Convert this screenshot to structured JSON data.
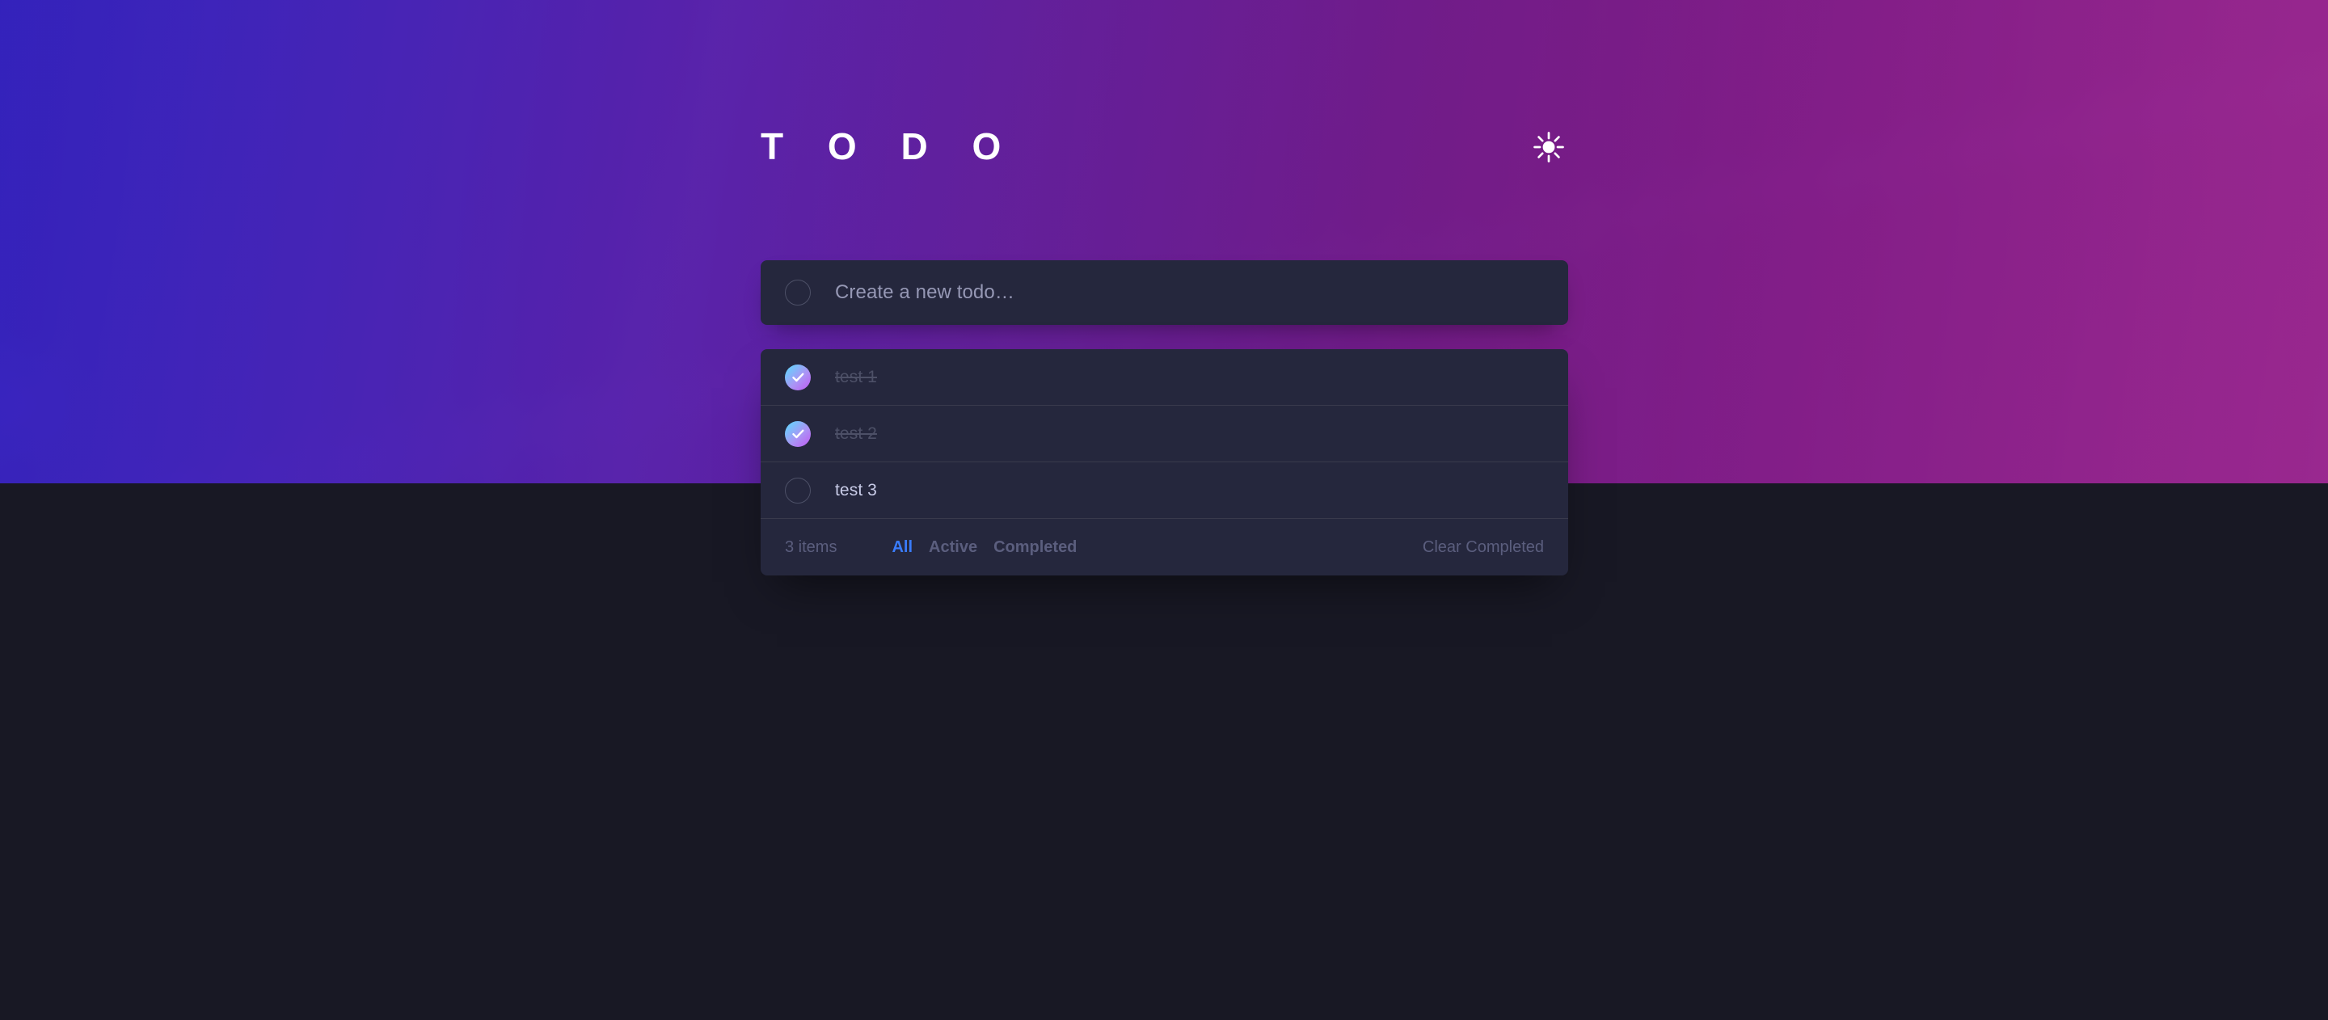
{
  "app": {
    "title": "T O D O",
    "theme_toggle_icon": "sun-icon",
    "theme_mode": "dark"
  },
  "new_todo": {
    "placeholder": "Create a new todo…",
    "value": "",
    "checkbox_icon": "empty-circle-icon"
  },
  "todos": [
    {
      "label": "test 1",
      "completed": true,
      "checkbox_icon": "check-icon"
    },
    {
      "label": "test 2",
      "completed": true,
      "checkbox_icon": "check-icon"
    },
    {
      "label": "test 3",
      "completed": false,
      "checkbox_icon": "empty-circle-icon"
    }
  ],
  "footer": {
    "items_left": "3 items",
    "filters": [
      {
        "label": "All",
        "active": true
      },
      {
        "label": "Active",
        "active": false
      },
      {
        "label": "Completed",
        "active": false
      }
    ],
    "clear_label": "Clear Completed"
  },
  "colors": {
    "accent_blue": "#3A7CFD",
    "card_bg": "#25273D",
    "page_bg": "#181824",
    "divider": "#393A4C",
    "text_primary": "#C8CBE7",
    "text_muted": "#5B5E7E",
    "gradient_start": "#57DDFF",
    "gradient_end": "#C058F3",
    "hero_gradient_start": "#3523C4",
    "hero_gradient_end": "#A52A97"
  }
}
